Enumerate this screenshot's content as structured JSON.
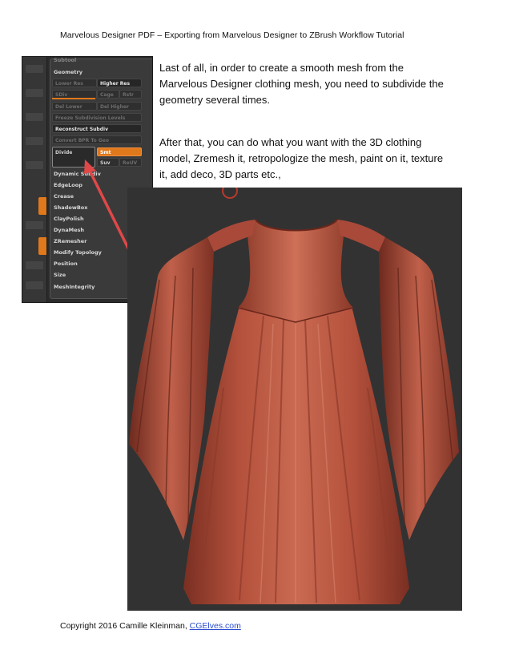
{
  "header": {
    "text": "Marvelous Designer PDF – Exporting from Marvelous Designer to ZBrush Workflow Tutorial"
  },
  "zbrush_panel": {
    "section_prev": "Subtool",
    "section": "Geometry",
    "lower_res": "Lower Res",
    "higher_res": "Higher Res",
    "sdiv": "SDiv",
    "cage": "Cage",
    "rstr": "Rstr",
    "del_lower": "Del Lower",
    "del_higher": "Del Higher",
    "freeze_subdivision": "Freeze Subdivision Levels",
    "reconstruct_subdiv": "Reconstruct Subdiv",
    "convert_bpr": "Convert BPR To Geo",
    "divide": "Divide",
    "smt": "Smt",
    "suv": "Suv",
    "reuv": "ReUV",
    "menu_items": [
      "Dynamic Subdiv",
      "EdgeLoop",
      "Crease",
      "ShadowBox",
      "ClayPolish",
      "DynaMesh",
      "ZRemesher",
      "Modify Topology",
      "Position",
      "Size",
      "MeshIntegrity"
    ]
  },
  "body": {
    "paragraph1": "Last of all, in order to create a smooth mesh from the Marvelous Designer clothing mesh, you need to subdivide the geometry several times.",
    "paragraph2": "After that, you can do what you want with the 3D clothing model, Zremesh it, retropologize the mesh, paint on it, texture it, add deco, 3D parts etc.,"
  },
  "footer": {
    "copyright": "Copyright 2016 Camille Kleinman, ",
    "link_text": "CGElves.com"
  },
  "colors": {
    "accent_orange": "#e0781c",
    "arrow_red": "#e04848",
    "dress_red": "#b4513c",
    "render_bg": "#323232",
    "link_blue": "#2a4cd0"
  }
}
